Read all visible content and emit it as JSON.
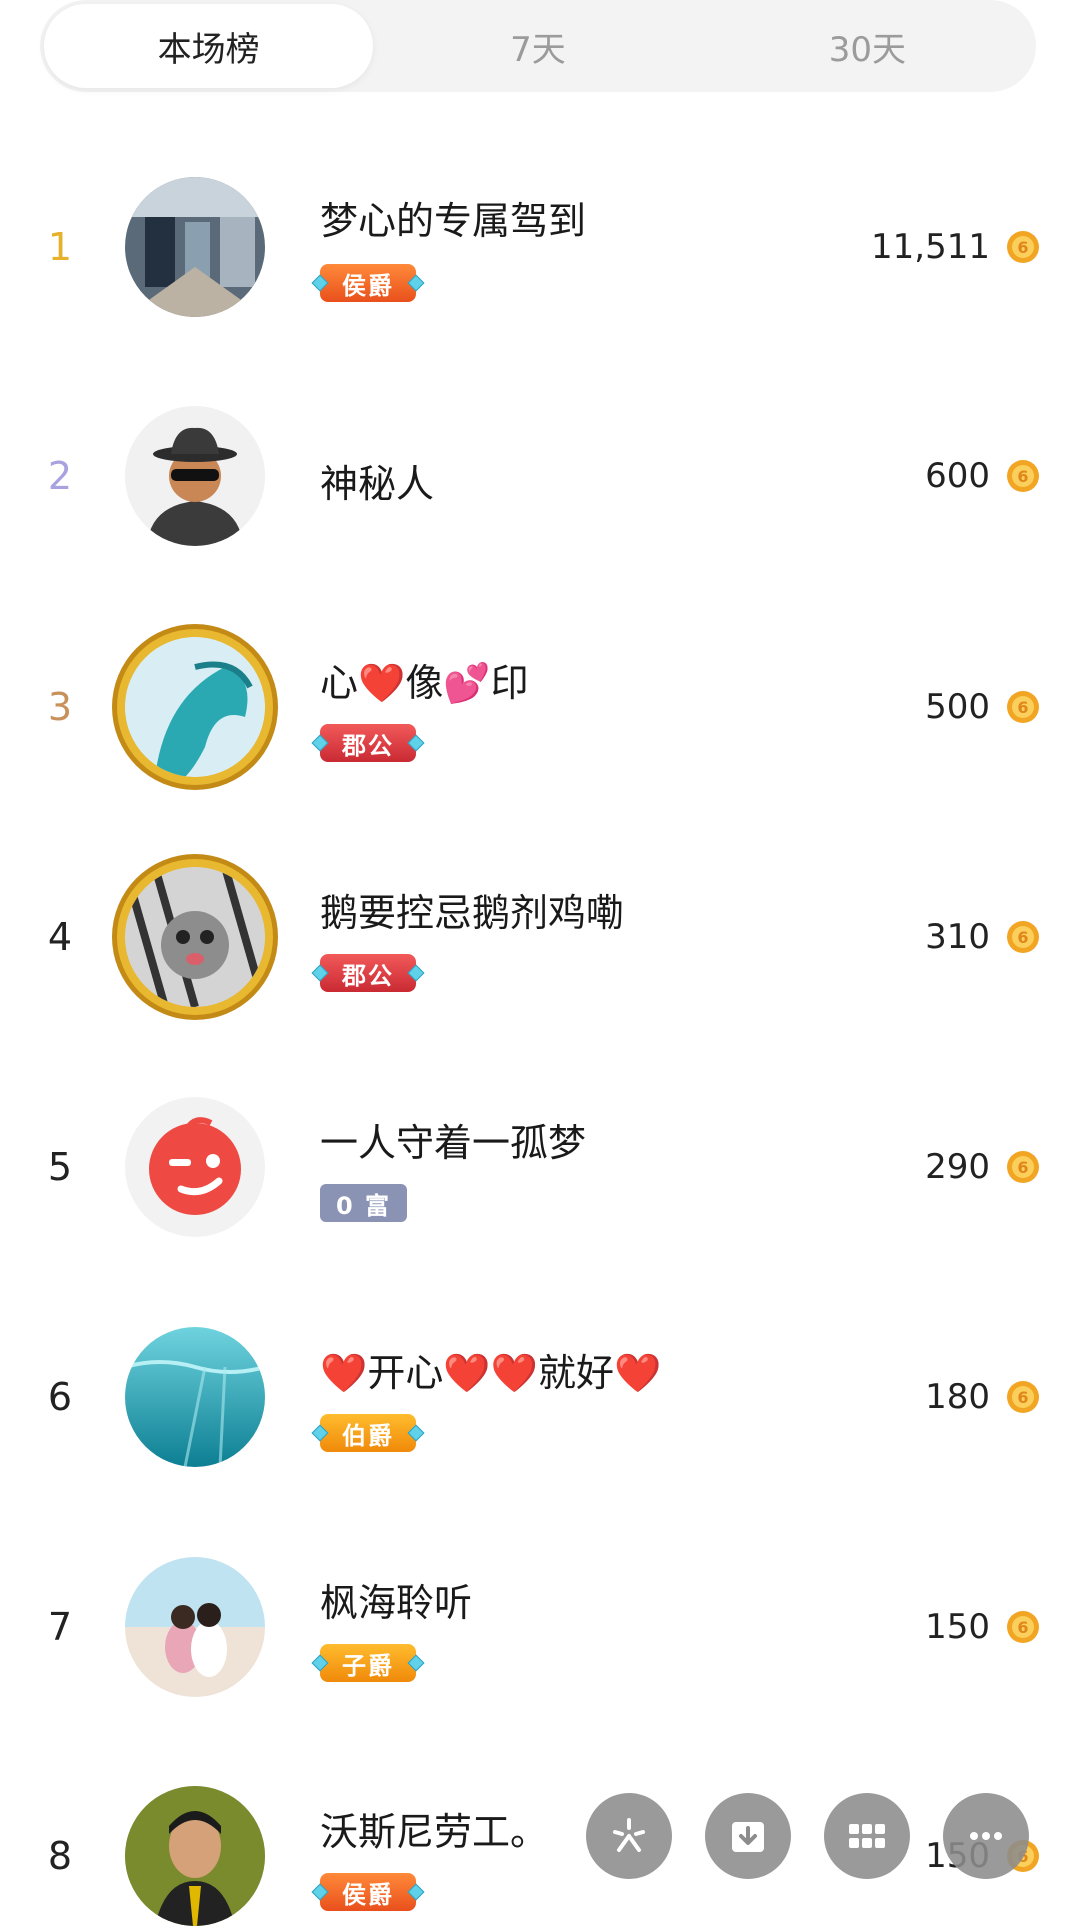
{
  "tabs": [
    {
      "label": "本场榜",
      "active": true
    },
    {
      "label": "7天",
      "active": false
    },
    {
      "label": "30天",
      "active": false
    }
  ],
  "coin_icon": "coin-icon",
  "colors": {
    "rank1": "#e6b12c",
    "rank2": "#a9a2e0",
    "rank3": "#c8915a",
    "rank_default": "#222222",
    "badge_houjue": "#f0662a",
    "badge_jungong": "#e0383e",
    "badge_bojue": "#f59a12",
    "badge_zijue": "#f5a20e",
    "badge_fu": "#8b93b5"
  },
  "rows": [
    {
      "rank": "1",
      "name": "梦心的专属驾到",
      "badge": "侯爵",
      "score": "11,511"
    },
    {
      "rank": "2",
      "name": "神秘人",
      "badge": "",
      "score": "600"
    },
    {
      "rank": "3",
      "name": "心❤️像💕印",
      "badge": "郡公",
      "score": "500"
    },
    {
      "rank": "4",
      "name": "鹅要控忌鹅剂鸡嘞",
      "badge": "郡公",
      "score": "310"
    },
    {
      "rank": "5",
      "name": "一人守着一孤梦",
      "badge": "0 富",
      "score": "290"
    },
    {
      "rank": "6",
      "name": "❤️开心❤️❤️就好❤️",
      "badge": "伯爵",
      "score": "180"
    },
    {
      "rank": "7",
      "name": "枫海聆听",
      "badge": "子爵",
      "score": "150"
    },
    {
      "rank": "8",
      "name": "沃斯尼劳工。",
      "badge": "侯爵",
      "score": "150"
    }
  ],
  "fabs": [
    "sparkle-icon",
    "download-icon",
    "grid-icon",
    "more-icon"
  ]
}
